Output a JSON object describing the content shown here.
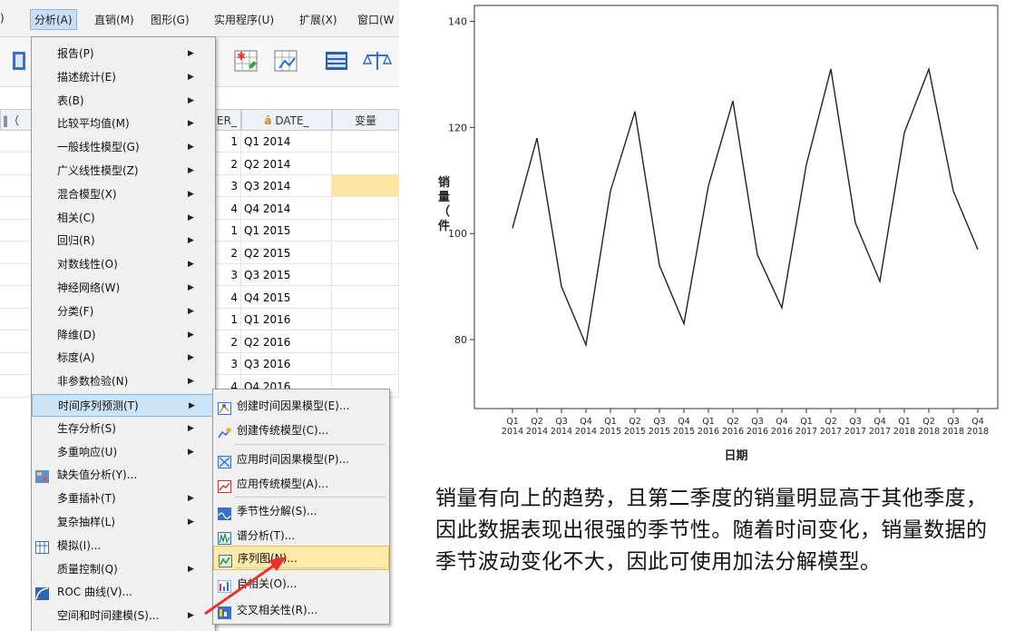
{
  "menubar": {
    "items": [
      {
        "label": ")",
        "x": 0
      },
      {
        "label": "分析(A)",
        "x": 38,
        "id": "analyze"
      },
      {
        "label": "直销(M)",
        "x": 104
      },
      {
        "label": "图形(G)",
        "x": 166
      },
      {
        "label": "实用程序(U)",
        "x": 236
      },
      {
        "label": "扩展(X)",
        "x": 330
      },
      {
        "label": "窗口(W",
        "x": 392
      }
    ]
  },
  "grid": {
    "headers": {
      "left": "‖（",
      "col1": "ER_",
      "col2": "DATE_",
      "col3": "变量"
    },
    "rows": [
      {
        "n": "1",
        "date": "Q1 2014"
      },
      {
        "n": "2",
        "date": "Q2 2014"
      },
      {
        "n": "3",
        "date": "Q3 2014"
      },
      {
        "n": "4",
        "date": "Q4 2014"
      },
      {
        "n": "1",
        "date": "Q1 2015"
      },
      {
        "n": "2",
        "date": "Q2 2015"
      },
      {
        "n": "3",
        "date": "Q3 2015"
      },
      {
        "n": "4",
        "date": "Q4 2015"
      },
      {
        "n": "1",
        "date": "Q1 2016"
      },
      {
        "n": "2",
        "date": "Q2 2016"
      },
      {
        "n": "3",
        "date": "Q3 2016"
      },
      {
        "n": "4",
        "date": "Q4 2016"
      }
    ]
  },
  "analyze_menu": {
    "items": [
      {
        "label": "报告(P)",
        "sub": true
      },
      {
        "label": "描述统计(E)",
        "sub": true
      },
      {
        "label": "表(B)",
        "sub": true
      },
      {
        "label": "比较平均值(M)",
        "sub": true
      },
      {
        "label": "一般线性模型(G)",
        "sub": true
      },
      {
        "label": "广义线性模型(Z)",
        "sub": true
      },
      {
        "label": "混合模型(X)",
        "sub": true
      },
      {
        "label": "相关(C)",
        "sub": true
      },
      {
        "label": "回归(R)",
        "sub": true
      },
      {
        "label": "对数线性(O)",
        "sub": true
      },
      {
        "label": "神经网络(W)",
        "sub": true
      },
      {
        "label": "分类(F)",
        "sub": true
      },
      {
        "label": "降维(D)",
        "sub": true
      },
      {
        "label": "标度(A)",
        "sub": true
      },
      {
        "label": "非参数检验(N)",
        "sub": true
      },
      {
        "label": "时间序列预测(T)",
        "sub": true,
        "highlight": true
      },
      {
        "label": "生存分析(S)",
        "sub": true
      },
      {
        "label": "多重响应(U)",
        "sub": true
      },
      {
        "label": "缺失值分析(Y)...",
        "sub": false,
        "icon": "missing-value-icon"
      },
      {
        "label": "多重插补(T)",
        "sub": true
      },
      {
        "label": "复杂抽样(L)",
        "sub": true
      },
      {
        "label": "模拟(I)...",
        "sub": false,
        "icon": "simulation-icon"
      },
      {
        "label": "质量控制(Q)",
        "sub": true
      },
      {
        "label": "ROC 曲线(V)...",
        "sub": false,
        "icon": "roc-curve-icon"
      },
      {
        "label": "空间和时间建模(S)...",
        "sub": true
      }
    ]
  },
  "forecast_menu": {
    "items": [
      {
        "label": "创建时间因果模型(E)...",
        "icon": "temporal-causal-icon"
      },
      {
        "label": "创建传统模型(C)...",
        "icon": "traditional-model-icon"
      },
      {
        "label": "应用时间因果模型(P)...",
        "icon": "apply-temporal-icon"
      },
      {
        "label": "应用传统模型(A)...",
        "icon": "apply-traditional-icon"
      },
      {
        "label": "季节性分解(S)...",
        "icon": "seasonal-decomposition-icon"
      },
      {
        "label": "谱分析(T)...",
        "icon": "spectral-analysis-icon"
      },
      {
        "label": "序列图(N)...",
        "icon": "sequence-chart-icon",
        "highlight": true
      },
      {
        "label": "自相关(O)...",
        "icon": "autocorrelation-icon"
      },
      {
        "label": "交叉相关性(R)...",
        "icon": "cross-correlation-icon"
      }
    ]
  },
  "colors": {
    "arrow": "#e8322c",
    "highlight_sub": "#fde9a8",
    "highlight_menu": "#cce4f7",
    "line": "#222222"
  },
  "chart_data": {
    "type": "line",
    "xlabel": "日期",
    "ylabel": "销量（件",
    "categories": [
      [
        "Q1",
        "2014"
      ],
      [
        "Q2",
        "2014"
      ],
      [
        "Q3",
        "2014"
      ],
      [
        "Q4",
        "2014"
      ],
      [
        "Q1",
        "2015"
      ],
      [
        "Q2",
        "2015"
      ],
      [
        "Q3",
        "2015"
      ],
      [
        "Q4",
        "2015"
      ],
      [
        "Q1",
        "2016"
      ],
      [
        "Q2",
        "2016"
      ],
      [
        "Q3",
        "2016"
      ],
      [
        "Q4",
        "2016"
      ],
      [
        "Q1",
        "2017"
      ],
      [
        "Q2",
        "2017"
      ],
      [
        "Q3",
        "2017"
      ],
      [
        "Q4",
        "2017"
      ],
      [
        "Q1",
        "2018"
      ],
      [
        "Q2",
        "2018"
      ],
      [
        "Q3",
        "2018"
      ],
      [
        "Q4",
        "2018"
      ]
    ],
    "values": [
      101,
      118,
      90,
      79,
      108,
      123,
      94,
      83,
      109,
      125,
      96,
      86,
      113,
      131,
      102,
      91,
      119,
      131,
      108,
      97
    ],
    "yticks": [
      80,
      100,
      120,
      140
    ],
    "ylim": [
      67,
      143
    ],
    "grid": false
  },
  "caption": "销量有向上的趋势，且第二季度的销量明显高于其他季度，因此数据表现出很强的季节性。随着时间变化，销量数据的季节波动变化不大，因此可使用加法分解模型。"
}
